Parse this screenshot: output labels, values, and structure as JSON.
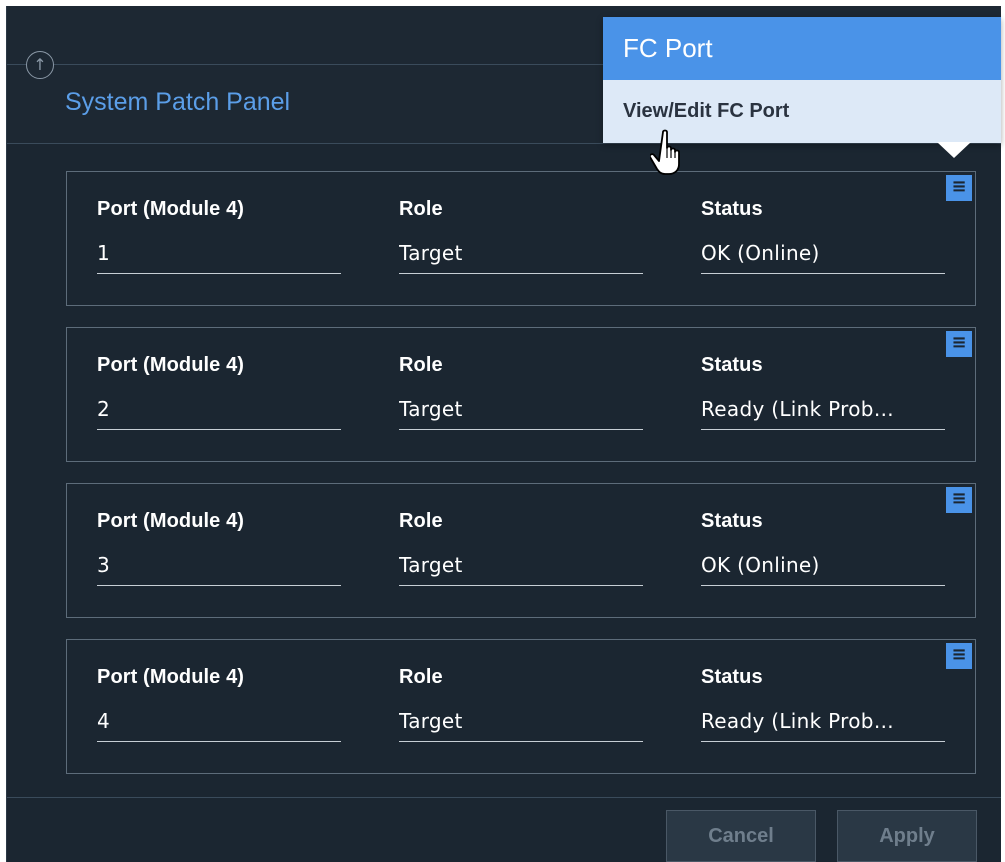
{
  "panel": {
    "title": "System Patch Panel",
    "collapse_icon": "arrow-up-circle-icon"
  },
  "ports": [
    {
      "port_label": "Port (Module 4)",
      "port": "1",
      "role_label": "Role",
      "role": "Target",
      "status_label": "Status",
      "status": "OK (Online)"
    },
    {
      "port_label": "Port (Module 4)",
      "port": "2",
      "role_label": "Role",
      "role": "Target",
      "status_label": "Status",
      "status": "Ready (Link Prob…"
    },
    {
      "port_label": "Port (Module 4)",
      "port": "3",
      "role_label": "Role",
      "role": "Target",
      "status_label": "Status",
      "status": "OK (Online)"
    },
    {
      "port_label": "Port (Module 4)",
      "port": "4",
      "role_label": "Role",
      "role": "Target",
      "status_label": "Status",
      "status": "Ready (Link Prob…"
    }
  ],
  "card_menu_icon": "hamburger-menu-icon",
  "popup": {
    "title": "FC Port",
    "item": "View/Edit FC Port"
  },
  "footer": {
    "cancel": "Cancel",
    "apply": "Apply"
  },
  "colors": {
    "panel_bg": "#1b2631",
    "accent": "#4a93e8",
    "title_blue": "#5b9ee8",
    "popup_bg": "#dde9f7"
  }
}
